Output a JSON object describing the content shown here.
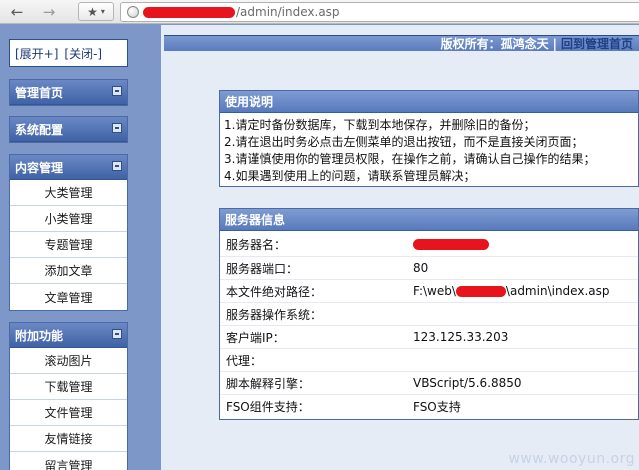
{
  "browser": {
    "url_path": "/admin/index.asp",
    "back_icon": "arrow-left-icon",
    "forward_icon": "arrow-right-icon",
    "bookmark_icon": "star-icon"
  },
  "left": {
    "expand": "[展开+]",
    "collapse": "[关闭-]",
    "menus": [
      {
        "title": "管理首页",
        "items": []
      },
      {
        "title": "系统配置",
        "items": []
      },
      {
        "title": "内容管理",
        "items": [
          "大类管理",
          "小类管理",
          "专题管理",
          "添加文章",
          "文章管理"
        ]
      },
      {
        "title": "附加功能",
        "items": [
          "滚动图片",
          "下载管理",
          "文件管理",
          "友情链接",
          "留言管理"
        ]
      }
    ]
  },
  "banner": {
    "copyright": "版权所有：孤鸿念天",
    "separator": "|",
    "home_link": "回到管理首页"
  },
  "instructions": {
    "title": "使用说明",
    "lines": [
      "1.请定时备份数据库，下载到本地保存，并删除旧的备份；",
      "2.请在退出时务必点击左侧菜单的退出按钮，而不是直接关闭页面；",
      "3.请谨慎使用你的管理员权限，在操作之前，请确认自己操作的结果；",
      "4.如果遇到使用上的问题，请联系管理员解决；"
    ]
  },
  "server": {
    "title": "服务器信息",
    "rows": [
      {
        "label": "服务器名：",
        "value": ""
      },
      {
        "label": "服务器端口：",
        "value": "80"
      },
      {
        "label": "本文件绝对路径：",
        "value_prefix": "F:\\web\\",
        "value_suffix": "\\admin\\index.asp"
      },
      {
        "label": "服务器操作系统：",
        "value": ""
      },
      {
        "label": "客户端IP：",
        "value": "123.125.33.203"
      },
      {
        "label": "代理：",
        "value": ""
      },
      {
        "label": "脚本解释引擎：",
        "value": "VBScript/5.6.8850"
      },
      {
        "label": "FSO组件支持：",
        "value": "FSO支持"
      }
    ]
  },
  "watermark": "www.wooyun.org",
  "colors": {
    "accent": "#4b6aa5",
    "redaction": "#e8141d"
  }
}
